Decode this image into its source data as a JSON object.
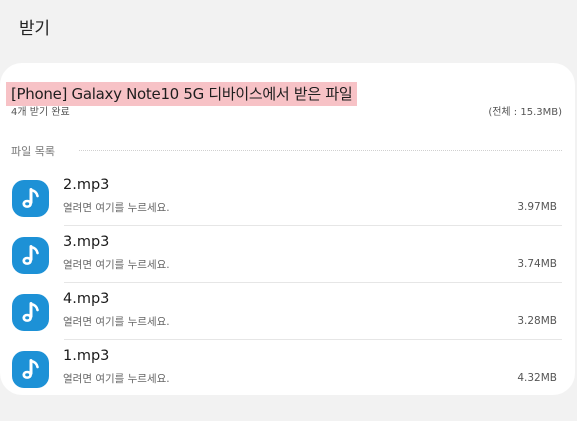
{
  "header": {
    "title": "받기"
  },
  "transfer": {
    "device_title": "[Phone] Galaxy Note10 5G 디바이스에서 받은 파일",
    "status": "4개 받기 완료",
    "total": "(전체 : 15.3MB)"
  },
  "file_section": {
    "label": "파일 목록"
  },
  "files": [
    {
      "name": "2.mp3",
      "hint": "열려면 여기를 누르세요.",
      "size": "3.97MB",
      "icon": "music-note-icon"
    },
    {
      "name": "3.mp3",
      "hint": "열려면 여기를 누르세요.",
      "size": "3.74MB",
      "icon": "music-note-icon"
    },
    {
      "name": "4.mp3",
      "hint": "열려면 여기를 누르세요.",
      "size": "3.28MB",
      "icon": "music-note-icon"
    },
    {
      "name": "1.mp3",
      "hint": "열려면 여기를 누르세요.",
      "size": "4.32MB",
      "icon": "music-note-icon"
    }
  ],
  "colors": {
    "icon_background": "#1d91d6",
    "highlight": "#f7c2c6"
  }
}
